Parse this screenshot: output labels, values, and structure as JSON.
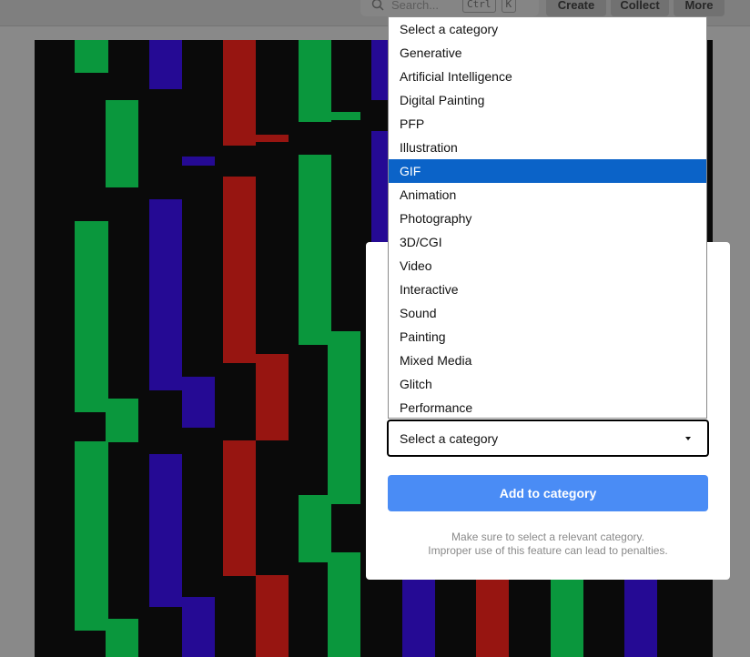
{
  "nav": {
    "search_placeholder": "Search...",
    "kbd_ctrl": "Ctrl",
    "kbd_k": "K",
    "create_label": "Create",
    "collect_label": "Collect",
    "more_label": "More"
  },
  "modal": {
    "select_value": "Select a category",
    "add_button_label": "Add to category",
    "note_line1": "Make sure to select a relevant category.",
    "note_line2": "Improper use of this feature can lead to penalties."
  },
  "dropdown": {
    "selected_index": 6,
    "options": [
      "Select a category",
      "Generative",
      "Artificial Intelligence",
      "Digital Painting",
      "PFP",
      "Illustration",
      "GIF",
      "Animation",
      "Photography",
      "3D/CGI",
      "Video",
      "Interactive",
      "Sound",
      "Painting",
      "Mixed Media",
      "Glitch",
      "Performance"
    ]
  },
  "colors": {
    "accent": "#4a8cf5",
    "selected_option": "#0b63c8",
    "art_green": "#009a38",
    "art_blue": "#1e0096",
    "art_red": "#9a0c08"
  }
}
